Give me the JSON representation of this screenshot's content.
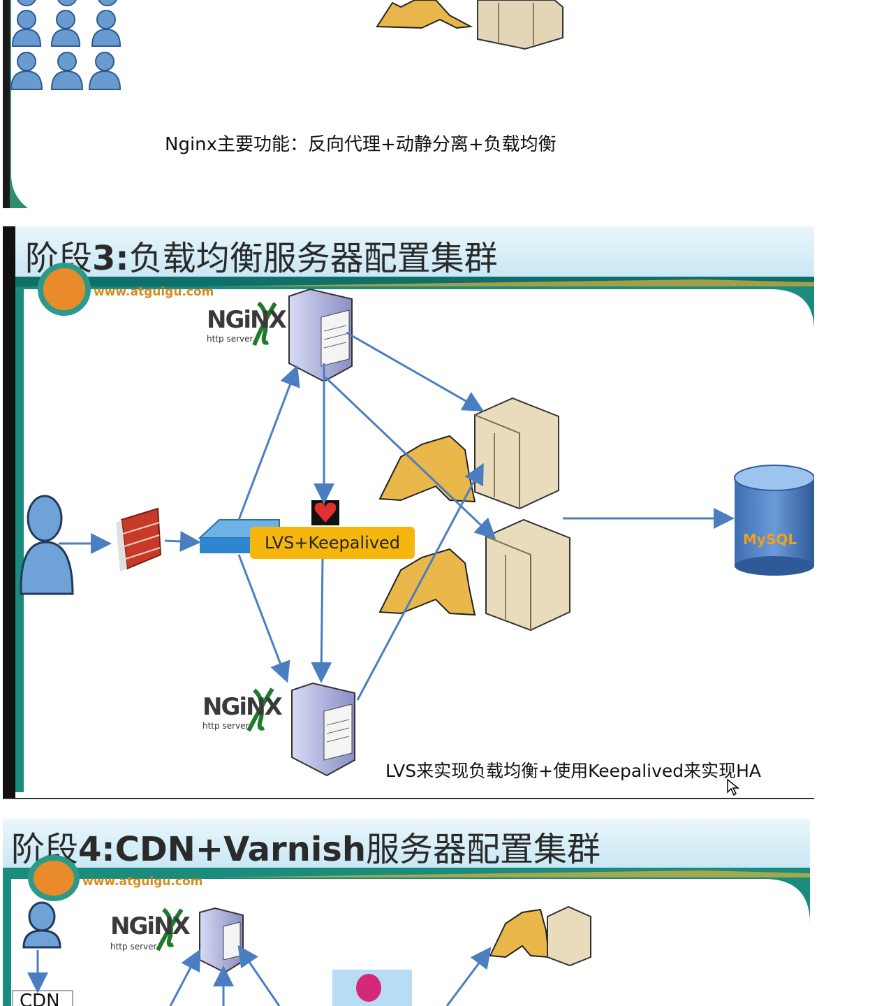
{
  "slide1": {
    "caption": "Nginx主要功能：反向代理+动静分离+负载均衡"
  },
  "slide2": {
    "title_prefix": "阶段",
    "title_number": "3:",
    "title_rest": "负载均衡服务器配置集群",
    "logo_url": "www.atguigu.com",
    "lvs_label": "LVS+Keepalived",
    "nginx_word": "NGiNX",
    "nginx_sub": "http server",
    "mysql_label": "MySQL",
    "caption": "LVS来实现负载均衡+使用Keepalived来实现HA"
  },
  "slide3": {
    "title_prefix": "阶段",
    "title_bold": "4:CDN+Varnish",
    "title_rest": "服务器配置集群",
    "logo_url": "www.atguigu.com",
    "nginx_word": "NGiNX",
    "nginx_sub": "http server",
    "cdn_label": "CDN"
  },
  "colors": {
    "arrow": "#4a7ec0",
    "title_bg": "#c9e8f5",
    "teal": "#0f7f7a",
    "lvs_box": "#f5b60d"
  }
}
